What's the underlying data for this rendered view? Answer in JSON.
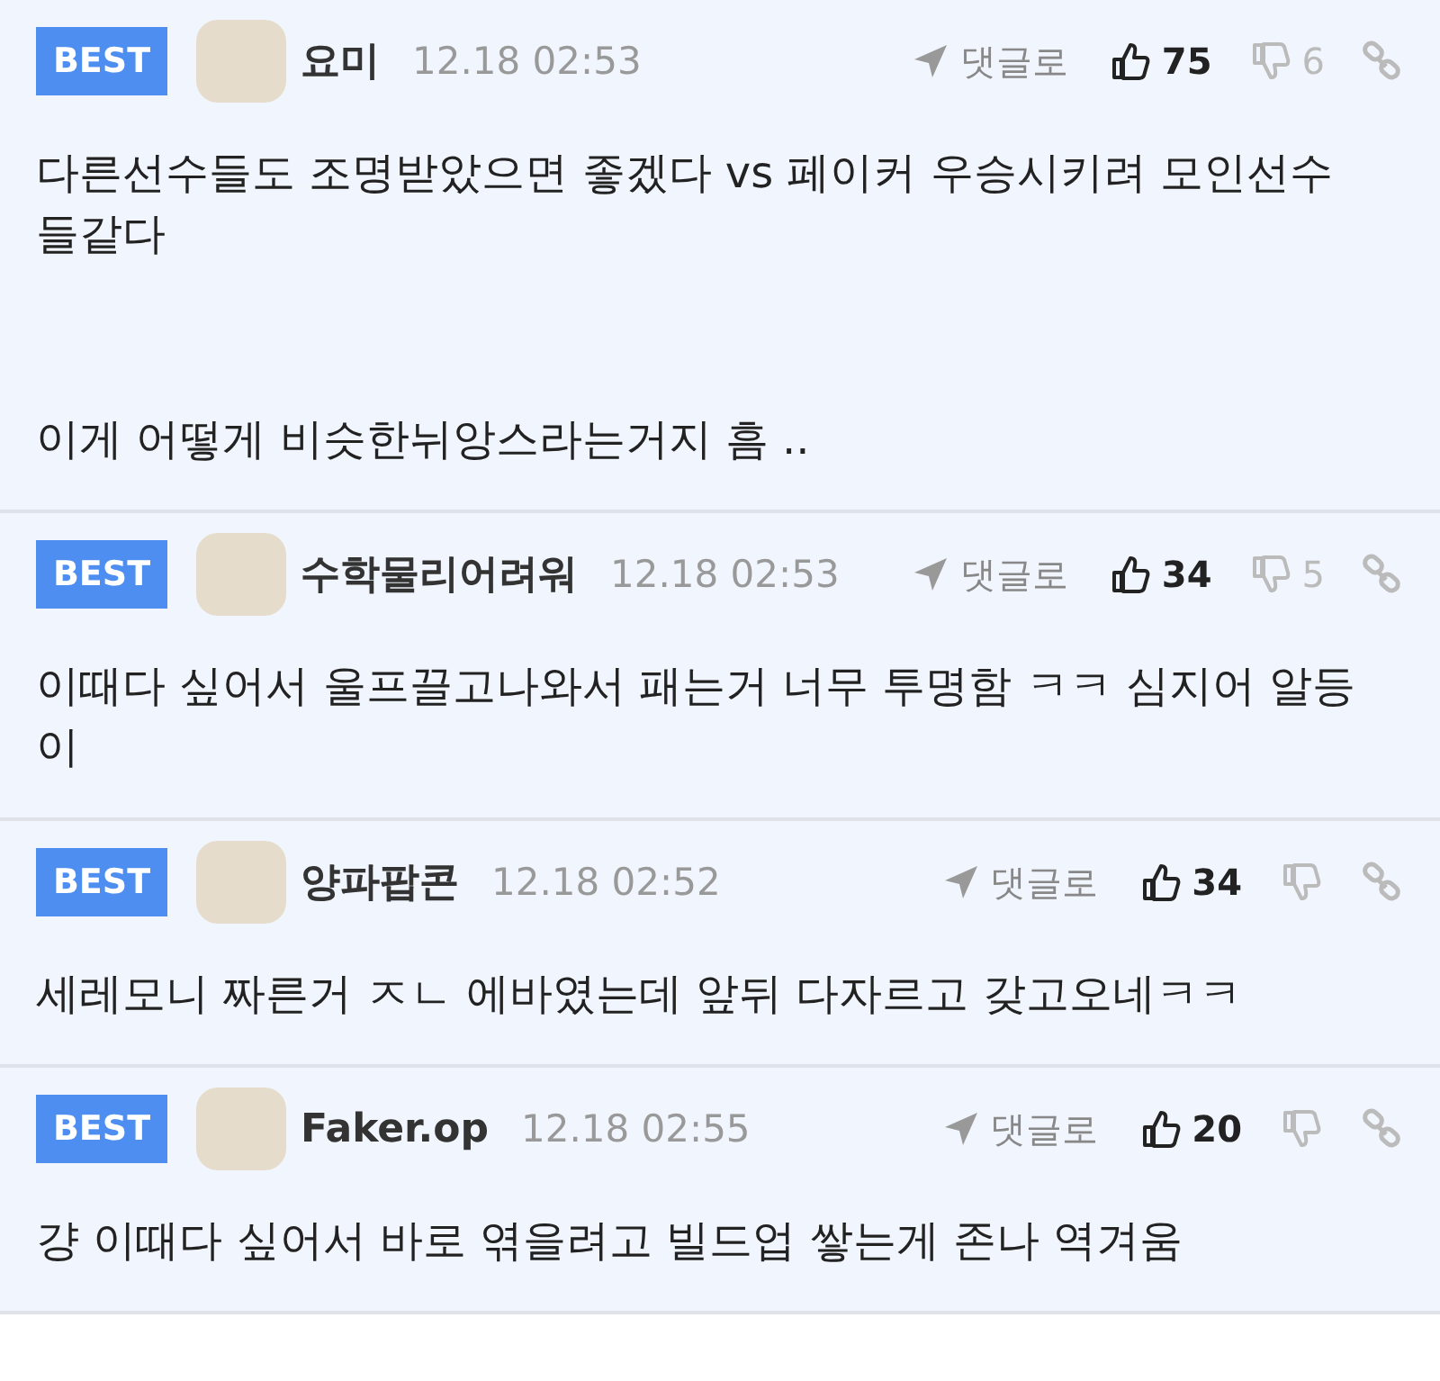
{
  "comments": [
    {
      "badge": "BEST",
      "nickname": "요미",
      "time": "12.18 02:53",
      "reply": "댓글로",
      "likes": "75",
      "dislikes": "6",
      "paragraphs": [
        "다른선수들도 조명받았으면 좋겠다 vs 페이커 우승시키려 모인선수들같다",
        "이게 어떻게 비슷한뉘앙스라는거지 흠 .."
      ]
    },
    {
      "badge": "BEST",
      "nickname": "수학물리어려워",
      "time": "12.18 02:53",
      "reply": "댓글로",
      "likes": "34",
      "dislikes": "5",
      "paragraphs": [
        "이때다 싶어서 울프끌고나와서 패는거 너무 투명함 ㅋㅋ 심지어 알등이"
      ]
    },
    {
      "badge": "BEST",
      "nickname": "양파팝콘",
      "time": "12.18 02:52",
      "reply": "댓글로",
      "likes": "34",
      "paragraphs": [
        "세레모니 짜른거 ㅈㄴ 에바였는데 앞뒤 다자르고 갖고오네ㅋㅋ"
      ]
    },
    {
      "badge": "BEST",
      "nickname": "Faker.op",
      "time": "12.18 02:55",
      "reply": "댓글로",
      "likes": "20",
      "paragraphs": [
        "걍 이때다 싶어서 바로 엮을려고 빌드업 쌓는게 존나 역겨움"
      ]
    }
  ]
}
